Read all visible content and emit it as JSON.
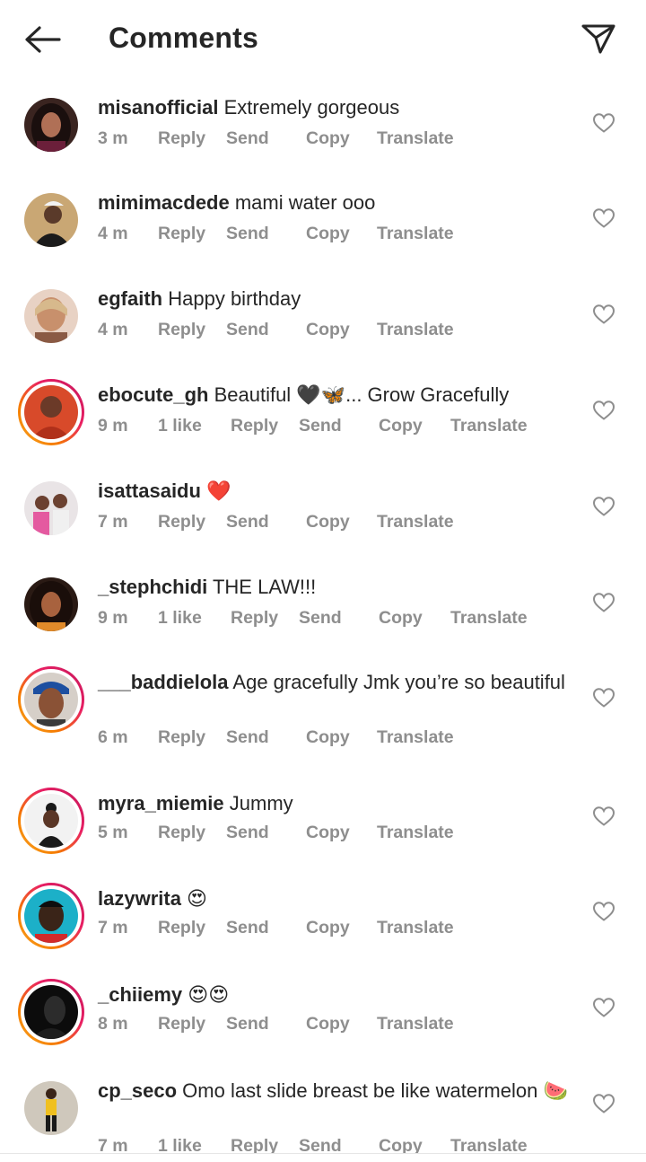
{
  "header": {
    "title": "Comments",
    "back_icon": "arrow-left-icon",
    "share_icon": "paper-plane-icon"
  },
  "actions": {
    "reply": "Reply",
    "send": "Send",
    "copy": "Copy",
    "translate": "Translate"
  },
  "comments": [
    {
      "username": "misanofficial",
      "text": " Extremely gorgeous",
      "time": "3 m",
      "likes": "",
      "story": false
    },
    {
      "username": "mimimacdede",
      "text": " mami water ooo",
      "time": "4 m",
      "likes": "",
      "story": false
    },
    {
      "username": "egfaith",
      "text": " Happy birthday",
      "time": "4 m",
      "likes": "",
      "story": false
    },
    {
      "username": "ebocute_gh",
      "text": " Beautiful 🖤🦋... Grow Gracefully",
      "time": "9 m",
      "likes": "1 like",
      "story": true
    },
    {
      "username": "isattasaidu",
      "text": " ❤️",
      "time": "7 m",
      "likes": "",
      "story": false
    },
    {
      "username": "_stephchidi",
      "text": " THE LAW!!!",
      "time": "9 m",
      "likes": "1 like",
      "story": false
    },
    {
      "username": "___baddielola",
      "text": " Age gracefully Jmk you’re so beautiful",
      "time": "6 m",
      "likes": "",
      "story": true
    },
    {
      "username": "myra_miemie",
      "text": " Jummy",
      "time": "5 m",
      "likes": "",
      "story": true
    },
    {
      "username": "lazywrita",
      "text": " 😍",
      "time": "7 m",
      "likes": "",
      "story": true
    },
    {
      "username": "_chiiemy",
      "text": " 😍😍",
      "time": "8 m",
      "likes": "",
      "story": true
    },
    {
      "username": "cp_seco",
      "text": " Omo last slide breast be like watermelon 🍉",
      "time": "7 m",
      "likes": "1 like",
      "story": false
    }
  ],
  "colors": {
    "text": "#262626",
    "meta": "#8e8e8e",
    "story_ring_start": "#f9a825",
    "story_ring_end": "#c2185b"
  }
}
